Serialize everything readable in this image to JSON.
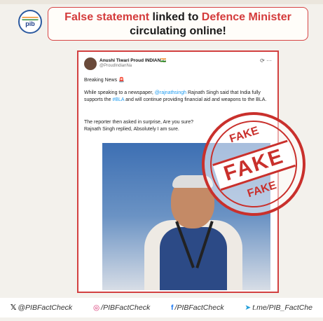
{
  "header": {
    "part1": "False statement",
    "part2": " linked to ",
    "part3": "Defence Minister",
    "line2": "circulating online!"
  },
  "tweet": {
    "name": "Anushi Tiwari Proud INDIAN🇮🇳",
    "handle": "@ProudIndianNa",
    "more": "⟳ ···",
    "breaking": "Breaking News 🚨",
    "p1_a": "While speaking to a newspaper, ",
    "p1_link1": "@rajnathsingh",
    "p1_b": " Rajnath Singh said that India fully supports the ",
    "p1_link2": "#BLA",
    "p1_c": " and will continue providing financial aid and weapons to the BLA.",
    "p2": "The reporter then asked in surprise, Are you sure?",
    "p3": "Rajnath Singh replied, Absolutely I am sure."
  },
  "stamp": {
    "top": "FAKE",
    "big": "FAKE",
    "bottom": "FAKE"
  },
  "footer": [
    {
      "icon": "𝕏",
      "text": "@PIBFactCheck"
    },
    {
      "icon": "◎",
      "text": "/PIBFactCheck"
    },
    {
      "icon": "f",
      "text": "/PIBFactCheck"
    },
    {
      "icon": "➤",
      "text": "t.me/PIB_FactChe"
    }
  ]
}
